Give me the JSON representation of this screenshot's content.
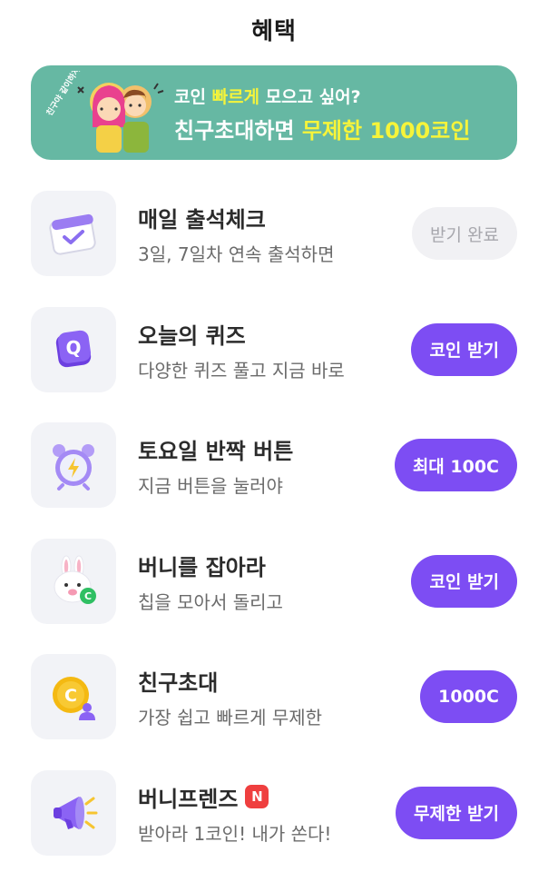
{
  "header": {
    "title": "혜택"
  },
  "banner": {
    "line1_prefix": "코인 ",
    "line1_highlight": "빠르게",
    "line1_suffix": " 모으고 싶어?",
    "line2_prefix": "친구초대하면 ",
    "line2_highlight": "무제한 1000코인",
    "badge_text": "친구야 같이하자~",
    "colors": {
      "background": "#66b8a3",
      "highlight": "#f6f43a"
    }
  },
  "benefits": [
    {
      "title": "매일 출석체크",
      "subtitle": "3일, 7일차 연속 출석하면",
      "button": "받기 완료",
      "icon": "calendar-check-icon",
      "button_state": "done"
    },
    {
      "title": "오늘의 퀴즈",
      "subtitle": "다양한 퀴즈 풀고 지금 바로",
      "button": "코인 받기",
      "icon": "quiz-q-icon"
    },
    {
      "title": "토요일 반짝 버튼",
      "subtitle": "지금 버튼을 눌러야",
      "button": "최대 100C",
      "icon": "alarm-clock-bolt-icon"
    },
    {
      "title": "버니를 잡아라",
      "subtitle": "칩을 모아서 돌리고",
      "button": "코인 받기",
      "icon": "bunny-coin-icon"
    },
    {
      "title": "친구초대",
      "subtitle": "가장 쉽고 빠르게 무제한",
      "button": "1000C",
      "icon": "coin-friend-icon"
    },
    {
      "title": "버니프렌즈",
      "subtitle": "받아라 1코인! 내가 쏜다!",
      "button": "무제한 받기",
      "icon": "megaphone-icon",
      "badge": "N"
    }
  ],
  "colors": {
    "accent": "#7d4df3",
    "done_bg": "#f1f1f4",
    "new_badge": "#ef3f3f"
  }
}
